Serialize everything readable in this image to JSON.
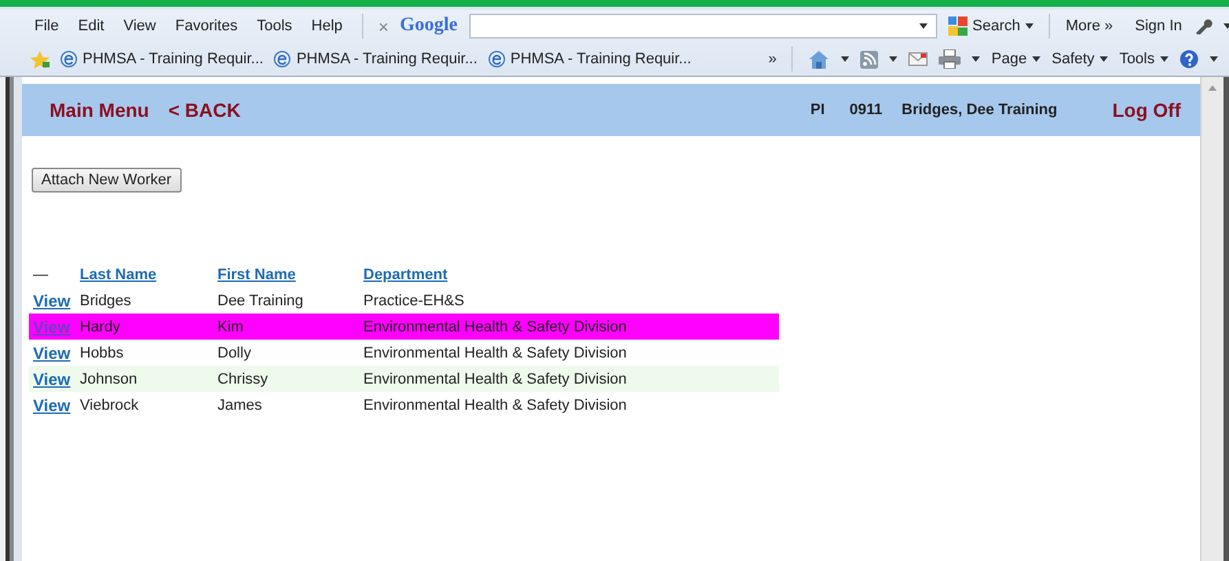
{
  "menu_bar": {
    "items": [
      "File",
      "Edit",
      "View",
      "Favorites",
      "Tools",
      "Help"
    ]
  },
  "google_toolbar": {
    "close": "×",
    "logo": "Google",
    "search_button": "Search",
    "more": "More »",
    "sign_in": "Sign In"
  },
  "favorites_bar": {
    "tabs": [
      "PHMSA - Training Requir...",
      "PHMSA - Training Requir...",
      "PHMSA - Training Requir..."
    ],
    "overflow": "»"
  },
  "command_bar": {
    "items": [
      "Page",
      "Safety",
      "Tools"
    ]
  },
  "header": {
    "main_menu": "Main Menu",
    "back": "< BACK",
    "role": "PI",
    "code": "0911",
    "user": "Bridges, Dee Training",
    "log_off": "Log Off"
  },
  "attach_button": "Attach New Worker",
  "table": {
    "columns": [
      "—",
      "Last Name",
      "First Name",
      "Department"
    ],
    "rows": [
      {
        "action": "View",
        "last_name": "Bridges",
        "first_name": "Dee Training",
        "department": "Practice-EH&S",
        "selected": false,
        "tinted": false
      },
      {
        "action": "View",
        "last_name": "Hardy",
        "first_name": "Kim",
        "department": "Environmental Health & Safety Division",
        "selected": true,
        "tinted": false
      },
      {
        "action": "View",
        "last_name": "Hobbs",
        "first_name": "Dolly",
        "department": "Environmental Health & Safety Division",
        "selected": false,
        "tinted": false
      },
      {
        "action": "View",
        "last_name": "Johnson",
        "first_name": "Chrissy",
        "department": "Environmental Health & Safety Division",
        "selected": false,
        "tinted": true
      },
      {
        "action": "View",
        "last_name": "Viebrock",
        "first_name": "James",
        "department": "Environmental Health & Safety Division",
        "selected": false,
        "tinted": false
      }
    ]
  }
}
